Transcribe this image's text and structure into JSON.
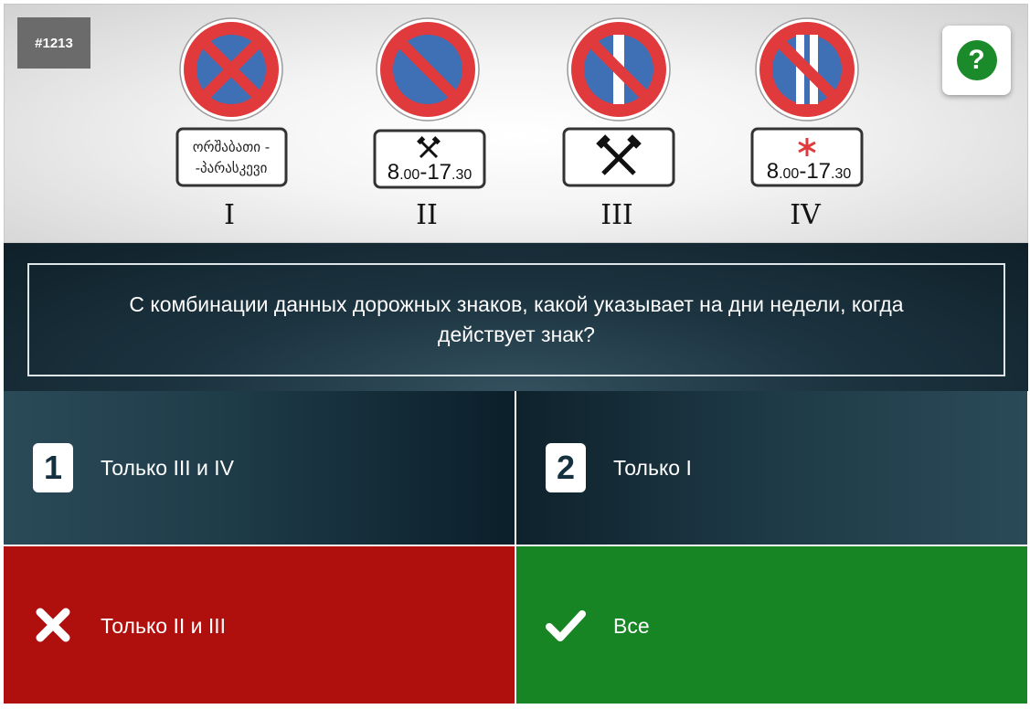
{
  "question_id": "#1213",
  "help_icon": "?",
  "signs": [
    {
      "numeral": "I",
      "plate_lines": [
        "ორშაბათი -",
        "-პარასკევი"
      ],
      "plate_type": "text"
    },
    {
      "numeral": "II",
      "plate_symbol": "hammers",
      "time_main": "8",
      "time_small1": ".00",
      "time_mid": "-17",
      "time_small2": ".30",
      "plate_type": "hammers-time"
    },
    {
      "numeral": "III",
      "plate_symbol": "hammers",
      "plate_type": "hammers"
    },
    {
      "numeral": "IV",
      "plate_symbol": "asterisk",
      "time_main": "8",
      "time_small1": ".00",
      "time_mid": "-17",
      "time_small2": ".30",
      "plate_type": "asterisk-time"
    }
  ],
  "question": "С комбинации данных дорожных знаков, какой указывает на дни недели, когда действует знак?",
  "answers": [
    {
      "badge": "1",
      "label": "Только III и IV",
      "state": "neutral"
    },
    {
      "badge": "2",
      "label": "Только I",
      "state": "neutral"
    },
    {
      "badge_icon": "cross-icon",
      "label": "Только II и III",
      "state": "wrong"
    },
    {
      "badge_icon": "check-icon",
      "label": "Все",
      "state": "correct"
    }
  ],
  "colors": {
    "wrong": "#b0100d",
    "correct": "#178523",
    "sign_red": "#e03a3c",
    "sign_blue": "#3f6fb5"
  }
}
